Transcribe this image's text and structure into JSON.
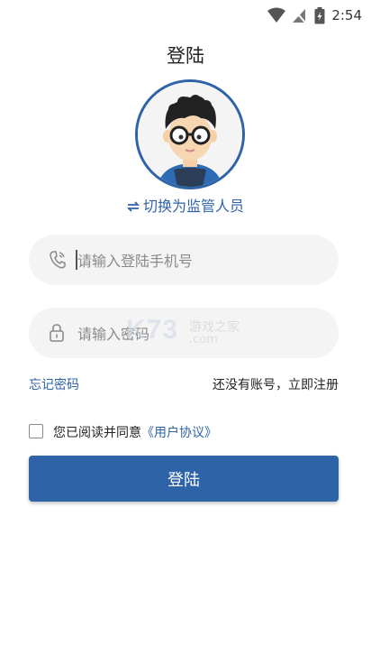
{
  "status_bar": {
    "time": "2:54",
    "icons": [
      "wifi-icon",
      "signal-icon",
      "battery-icon"
    ]
  },
  "page_title": "登陆",
  "switch_role": {
    "label": "切换为监管人员",
    "icon": "swap-icon"
  },
  "phone_field": {
    "placeholder": "请输入登陆手机号",
    "value": "",
    "icon": "phone-icon"
  },
  "password_field": {
    "placeholder": "请输入密码",
    "value": "",
    "icon": "lock-icon"
  },
  "watermark": {
    "mark": "K73",
    "sub": "游戏之家",
    "domain": ".com"
  },
  "links": {
    "forgot_password": "忘记密码",
    "register": "还没有账号，立即注册"
  },
  "agreement": {
    "checked": false,
    "text": "您已阅读并同意",
    "link": "《用户协议》"
  },
  "login_button": "登陆",
  "colors": {
    "accent": "#2f63a8",
    "field_bg": "#f4f4f4",
    "text": "#222222"
  }
}
